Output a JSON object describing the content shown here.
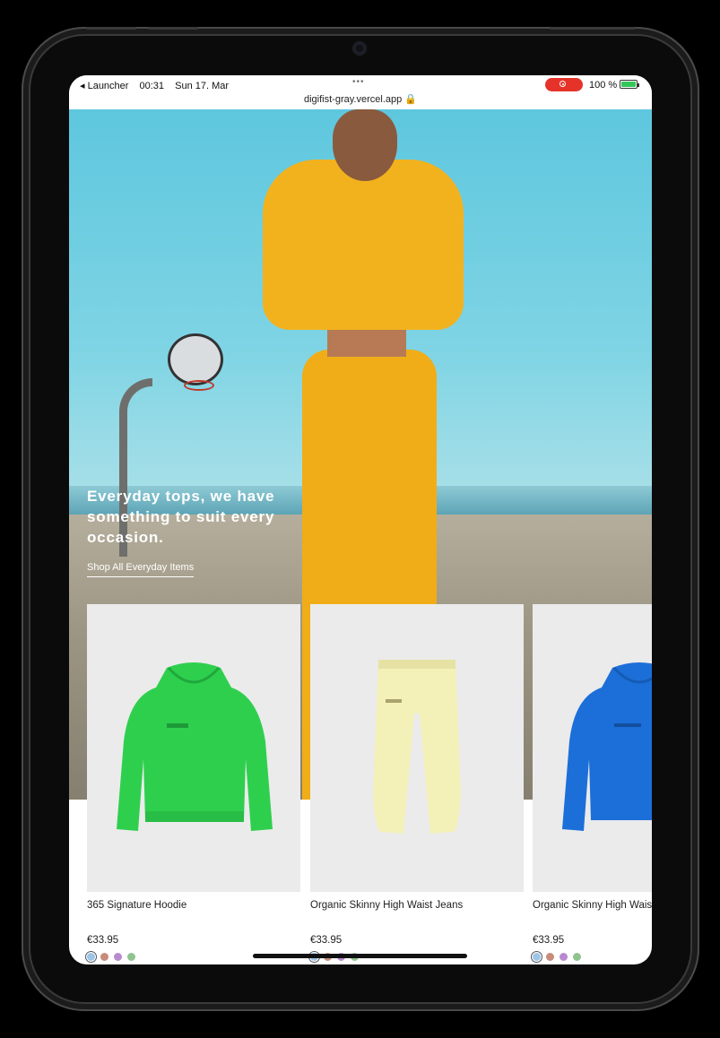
{
  "status_bar": {
    "back_app": "◂ Launcher",
    "time": "00:31",
    "date": "Sun 17. Mar",
    "url": "digifist-gray.vercel.app 🔒",
    "battery": "100 %"
  },
  "hero": {
    "title": "Everyday tops, we have something to suit every occasion.",
    "link": "Shop All Everyday Items"
  },
  "products": [
    {
      "name": "365 Signature Hoodie",
      "price": "€33.95",
      "color": "#2fcf4e",
      "swatches": [
        "#9ec5e8",
        "#c98b7b",
        "#b98ad0",
        "#8fc48f"
      ]
    },
    {
      "name": "Organic Skinny High Waist Jeans",
      "price": "€33.95",
      "color": "#f3f0b8",
      "swatches": [
        "#9ec5e8",
        "#c98b7b",
        "#b98ad0",
        "#8fc48f"
      ]
    },
    {
      "name": "Organic Skinny High Waist Jeans",
      "price": "€33.95",
      "color": "#1c6fd8",
      "swatches": [
        "#9ec5e8",
        "#c98b7b",
        "#b98ad0",
        "#8fc48f"
      ]
    }
  ]
}
